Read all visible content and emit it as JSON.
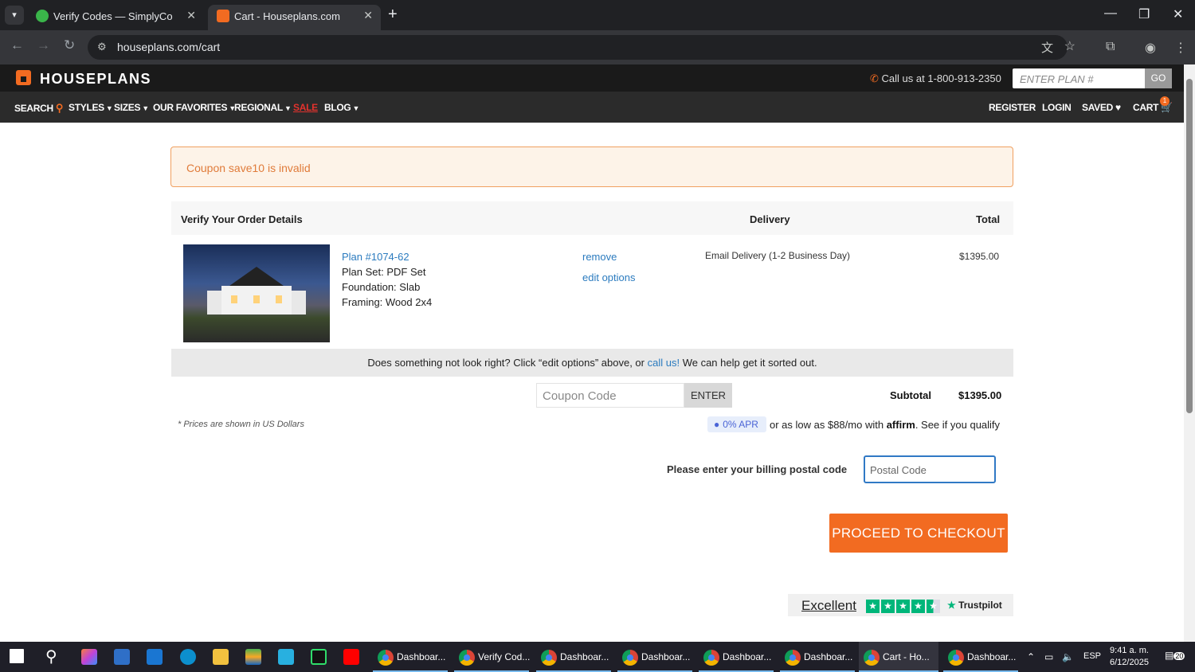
{
  "browser": {
    "tabs": [
      {
        "title": "Verify Codes — SimplyCodes",
        "icon": "simplycodes-icon"
      },
      {
        "title": "Cart - Houseplans.com",
        "icon": "houseplans-icon"
      }
    ],
    "url": "houseplans.com/cart"
  },
  "site": {
    "logo": "HOUSEPLANS",
    "call": "Call us at 1-800-913-2350",
    "plan_placeholder": "ENTER PLAN #",
    "go": "GO",
    "menu": {
      "search": "SEARCH",
      "styles": "STYLES",
      "sizes": "SIZES",
      "favorites": "OUR FAVORITES",
      "regional": "REGIONAL",
      "sale": "SALE",
      "blog": "BLOG",
      "register": "REGISTER",
      "login": "LOGIN",
      "saved": "SAVED",
      "cart": "CART",
      "cart_count": "1"
    }
  },
  "alert": "Coupon save10 is invalid",
  "order": {
    "heading": "Verify Your Order Details",
    "delivery_heading": "Delivery",
    "total_heading": "Total",
    "plan_link": "Plan #1074-62",
    "plan_set": "Plan Set: PDF Set",
    "foundation": "Foundation: Slab",
    "framing": "Framing: Wood 2x4",
    "remove": "remove",
    "edit": "edit options",
    "delivery": "Email Delivery (1-2 Business Day)",
    "price": "$1395.00",
    "help_pre": "Does something not look right?  Click “edit options” above, or ",
    "help_link": "call us!",
    "help_post": "  We can help get it sorted out.",
    "coupon_placeholder": "Coupon Code",
    "enter": "ENTER",
    "subtotal_label": "Subtotal",
    "subtotal": "$1395.00",
    "apr": "0% APR",
    "affirm_pre": "or as low as $88/mo with ",
    "affirm_brand": "affirm",
    "affirm_post": ". See if you qualify",
    "prices_note": "* Prices are shown in US Dollars"
  },
  "billing": {
    "label": "Please enter your billing postal code",
    "placeholder": "Postal Code"
  },
  "checkout": "PROCEED TO CHECKOUT",
  "trustpilot": {
    "rating_word": "Excellent",
    "stars": 4.5,
    "brand": "Trustpilot"
  },
  "taskbar": {
    "apps": [
      {
        "label": "Dashboar..."
      },
      {
        "label": "Verify Cod..."
      },
      {
        "label": "Dashboar..."
      },
      {
        "label": "Dashboar..."
      },
      {
        "label": "Dashboar..."
      },
      {
        "label": "Dashboar..."
      },
      {
        "label": "Cart - Ho..."
      },
      {
        "label": "Dashboar..."
      }
    ],
    "lang": "ESP",
    "time": "9:41 a. m.",
    "date": "6/12/2025",
    "notifications": "20"
  }
}
